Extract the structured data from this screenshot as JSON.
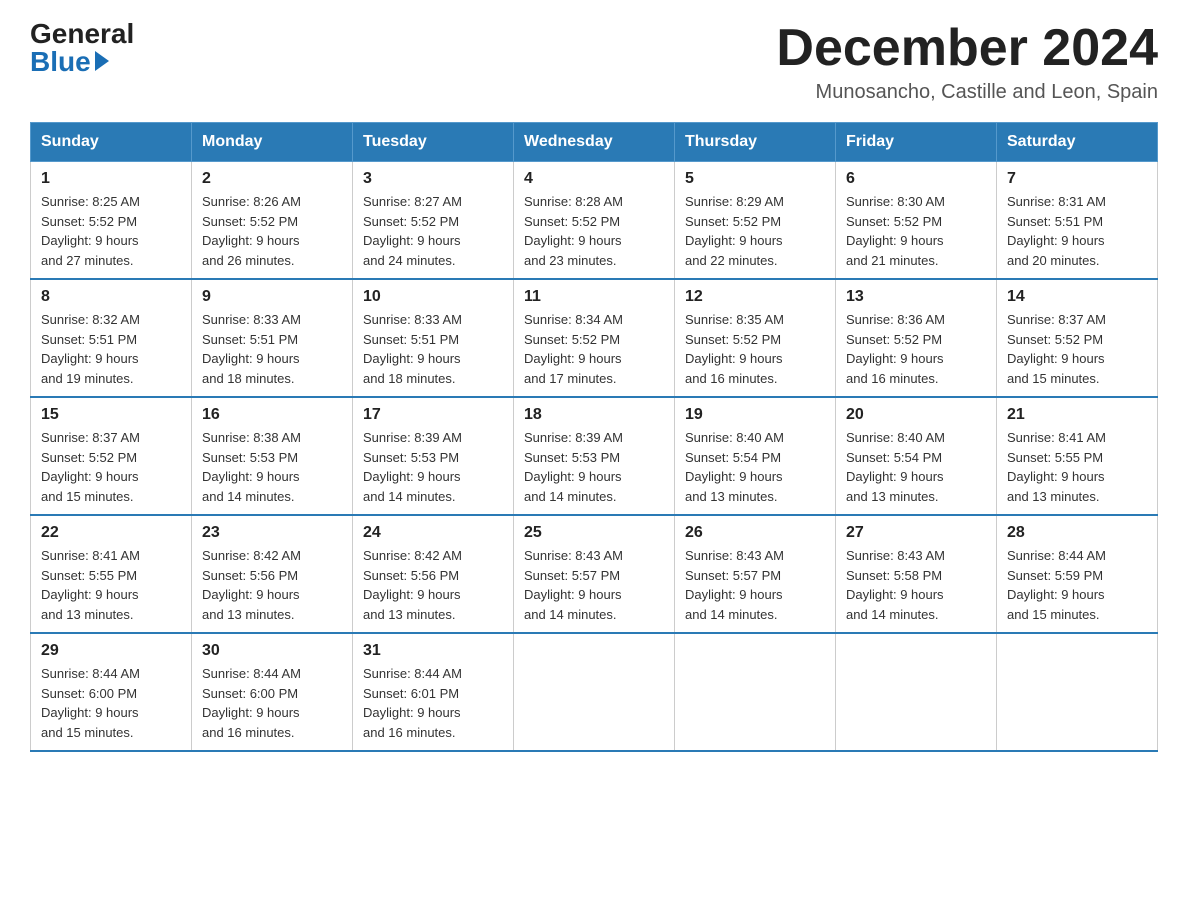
{
  "header": {
    "logo_general": "General",
    "logo_blue": "Blue",
    "month_year": "December 2024",
    "location": "Munosancho, Castille and Leon, Spain"
  },
  "days_of_week": [
    "Sunday",
    "Monday",
    "Tuesday",
    "Wednesday",
    "Thursday",
    "Friday",
    "Saturday"
  ],
  "weeks": [
    [
      {
        "day": "1",
        "sunrise": "8:25 AM",
        "sunset": "5:52 PM",
        "daylight": "9 hours and 27 minutes."
      },
      {
        "day": "2",
        "sunrise": "8:26 AM",
        "sunset": "5:52 PM",
        "daylight": "9 hours and 26 minutes."
      },
      {
        "day": "3",
        "sunrise": "8:27 AM",
        "sunset": "5:52 PM",
        "daylight": "9 hours and 24 minutes."
      },
      {
        "day": "4",
        "sunrise": "8:28 AM",
        "sunset": "5:52 PM",
        "daylight": "9 hours and 23 minutes."
      },
      {
        "day": "5",
        "sunrise": "8:29 AM",
        "sunset": "5:52 PM",
        "daylight": "9 hours and 22 minutes."
      },
      {
        "day": "6",
        "sunrise": "8:30 AM",
        "sunset": "5:52 PM",
        "daylight": "9 hours and 21 minutes."
      },
      {
        "day": "7",
        "sunrise": "8:31 AM",
        "sunset": "5:51 PM",
        "daylight": "9 hours and 20 minutes."
      }
    ],
    [
      {
        "day": "8",
        "sunrise": "8:32 AM",
        "sunset": "5:51 PM",
        "daylight": "9 hours and 19 minutes."
      },
      {
        "day": "9",
        "sunrise": "8:33 AM",
        "sunset": "5:51 PM",
        "daylight": "9 hours and 18 minutes."
      },
      {
        "day": "10",
        "sunrise": "8:33 AM",
        "sunset": "5:51 PM",
        "daylight": "9 hours and 18 minutes."
      },
      {
        "day": "11",
        "sunrise": "8:34 AM",
        "sunset": "5:52 PM",
        "daylight": "9 hours and 17 minutes."
      },
      {
        "day": "12",
        "sunrise": "8:35 AM",
        "sunset": "5:52 PM",
        "daylight": "9 hours and 16 minutes."
      },
      {
        "day": "13",
        "sunrise": "8:36 AM",
        "sunset": "5:52 PM",
        "daylight": "9 hours and 16 minutes."
      },
      {
        "day": "14",
        "sunrise": "8:37 AM",
        "sunset": "5:52 PM",
        "daylight": "9 hours and 15 minutes."
      }
    ],
    [
      {
        "day": "15",
        "sunrise": "8:37 AM",
        "sunset": "5:52 PM",
        "daylight": "9 hours and 15 minutes."
      },
      {
        "day": "16",
        "sunrise": "8:38 AM",
        "sunset": "5:53 PM",
        "daylight": "9 hours and 14 minutes."
      },
      {
        "day": "17",
        "sunrise": "8:39 AM",
        "sunset": "5:53 PM",
        "daylight": "9 hours and 14 minutes."
      },
      {
        "day": "18",
        "sunrise": "8:39 AM",
        "sunset": "5:53 PM",
        "daylight": "9 hours and 14 minutes."
      },
      {
        "day": "19",
        "sunrise": "8:40 AM",
        "sunset": "5:54 PM",
        "daylight": "9 hours and 13 minutes."
      },
      {
        "day": "20",
        "sunrise": "8:40 AM",
        "sunset": "5:54 PM",
        "daylight": "9 hours and 13 minutes."
      },
      {
        "day": "21",
        "sunrise": "8:41 AM",
        "sunset": "5:55 PM",
        "daylight": "9 hours and 13 minutes."
      }
    ],
    [
      {
        "day": "22",
        "sunrise": "8:41 AM",
        "sunset": "5:55 PM",
        "daylight": "9 hours and 13 minutes."
      },
      {
        "day": "23",
        "sunrise": "8:42 AM",
        "sunset": "5:56 PM",
        "daylight": "9 hours and 13 minutes."
      },
      {
        "day": "24",
        "sunrise": "8:42 AM",
        "sunset": "5:56 PM",
        "daylight": "9 hours and 13 minutes."
      },
      {
        "day": "25",
        "sunrise": "8:43 AM",
        "sunset": "5:57 PM",
        "daylight": "9 hours and 14 minutes."
      },
      {
        "day": "26",
        "sunrise": "8:43 AM",
        "sunset": "5:57 PM",
        "daylight": "9 hours and 14 minutes."
      },
      {
        "day": "27",
        "sunrise": "8:43 AM",
        "sunset": "5:58 PM",
        "daylight": "9 hours and 14 minutes."
      },
      {
        "day": "28",
        "sunrise": "8:44 AM",
        "sunset": "5:59 PM",
        "daylight": "9 hours and 15 minutes."
      }
    ],
    [
      {
        "day": "29",
        "sunrise": "8:44 AM",
        "sunset": "6:00 PM",
        "daylight": "9 hours and 15 minutes."
      },
      {
        "day": "30",
        "sunrise": "8:44 AM",
        "sunset": "6:00 PM",
        "daylight": "9 hours and 16 minutes."
      },
      {
        "day": "31",
        "sunrise": "8:44 AM",
        "sunset": "6:01 PM",
        "daylight": "9 hours and 16 minutes."
      },
      null,
      null,
      null,
      null
    ]
  ],
  "sunrise_label": "Sunrise:",
  "sunset_label": "Sunset:",
  "daylight_label": "Daylight:"
}
